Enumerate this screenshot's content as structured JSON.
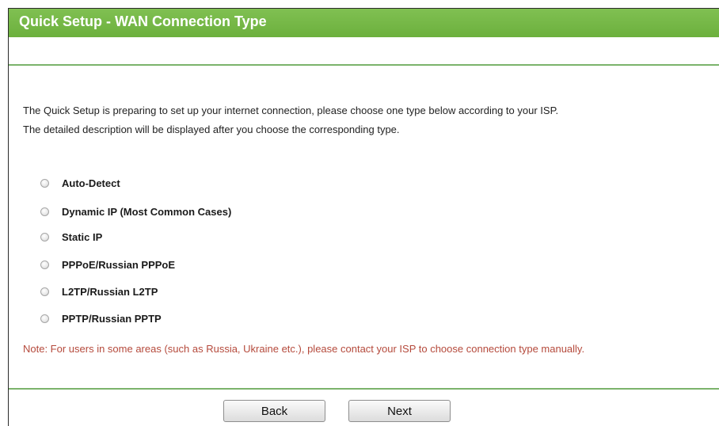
{
  "header": {
    "title": "Quick Setup - WAN Connection Type"
  },
  "intro": {
    "line1": "The Quick Setup is preparing to set up your internet connection, please choose one type below according to your ISP.",
    "line2": "The detailed description will be displayed after you choose the corresponding type."
  },
  "options": [
    {
      "label": "Auto-Detect",
      "selected": false
    },
    {
      "label": "Dynamic IP (Most Common Cases)",
      "selected": false
    },
    {
      "label": "Static IP",
      "selected": false
    },
    {
      "label": "PPPoE/Russian PPPoE",
      "selected": false
    },
    {
      "label": "L2TP/Russian L2TP",
      "selected": false
    },
    {
      "label": "PPTP/Russian PPTP",
      "selected": false
    }
  ],
  "note": "Note: For users in some areas (such as Russia, Ukraine etc.), please contact your ISP to choose connection type manually.",
  "buttons": {
    "back": "Back",
    "next": "Next"
  },
  "colors": {
    "title_bar": "#73b746",
    "divider": "#7bb36b",
    "note_text": "#b54a3c"
  }
}
